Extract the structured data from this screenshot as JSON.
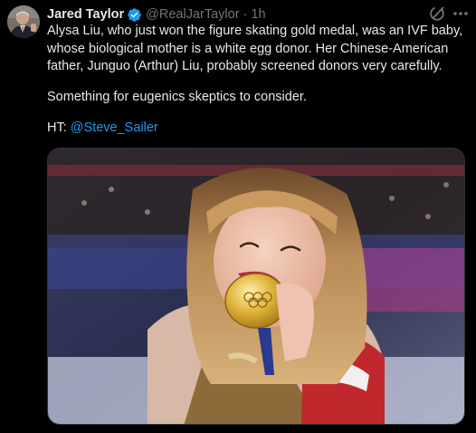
{
  "tweet": {
    "author": {
      "display_name": "Jared Taylor",
      "verified": true,
      "handle": "@RealJarTaylor",
      "separator": "·",
      "time": "1h"
    },
    "body": {
      "paragraph_1": "Alysa Liu, who just won the figure skating gold medal, was an IVF baby, whose biological mother is a white egg donor. Her Chinese-American father, Junguo (Arthur) Liu, probably screened donors very carefully.",
      "paragraph_2": "Something for eugenics skeptics to consider.",
      "ht_prefix": "HT: ",
      "ht_mention": "@Steve_Sailer"
    },
    "icons": {
      "verified": "verified-badge-icon",
      "grok": "grok-icon",
      "more": "more-options-icon"
    },
    "colors": {
      "background": "#000000",
      "text": "#e7e9ea",
      "secondary_text": "#71767b",
      "link": "#1d9bf0",
      "verified_badge": "#1d9bf0"
    }
  }
}
